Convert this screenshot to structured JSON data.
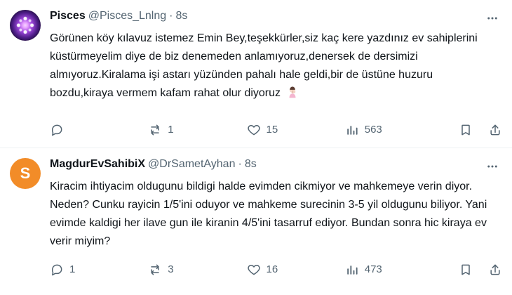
{
  "tweets": [
    {
      "display_name": "Pisces",
      "handle": "@Pisces_Lnlng",
      "time": "8s",
      "text": "Görünen köy kılavuz istemez Emin Bey,teşekkürler,siz kaç kere yazdınız ev sahiplerini küstürmeyelim diye de biz denemeden anlamıyoruz,denersek de dersimizi almıyoruz.Kiralama işi astarı yüzünden pahalı hale geldi,bir de üstüne huzuru bozdu,kiraya vermem kafam rahat olur diyoruz",
      "reply_count": "",
      "retweet_count": "1",
      "like_count": "15",
      "view_count": "563",
      "avatar_text": ""
    },
    {
      "display_name": "MagdurEvSahibiX",
      "handle": "@DrSametAyhan",
      "time": "8s",
      "text": "Kiracim ihtiyacim oldugunu bildigi halde evimden cikmiyor ve mahkemeye verin diyor. Neden? Cunku rayicin 1/5'ini oduyor ve mahkeme surecinin 3-5 yil oldugunu biliyor. Yani evimde kaldigi her ilave gun ile kiranin 4/5'ini tasarruf ediyor. Bundan sonra hic kiraya ev verir miyim?",
      "reply_count": "1",
      "retweet_count": "3",
      "like_count": "16",
      "view_count": "473",
      "avatar_text": "S"
    }
  ],
  "ui": {
    "dot": "·"
  },
  "icons": {
    "reply": "reply-icon",
    "retweet": "retweet-icon",
    "like": "heart-icon",
    "views": "views-icon",
    "bookmark": "bookmark-icon",
    "share": "share-icon",
    "more": "more-icon",
    "emoji": "person-facepalming-emoji"
  },
  "colors": {
    "text_primary": "#0f1419",
    "text_secondary": "#536471",
    "divider": "#eff3f4",
    "avatar_orange": "#f28c28"
  }
}
